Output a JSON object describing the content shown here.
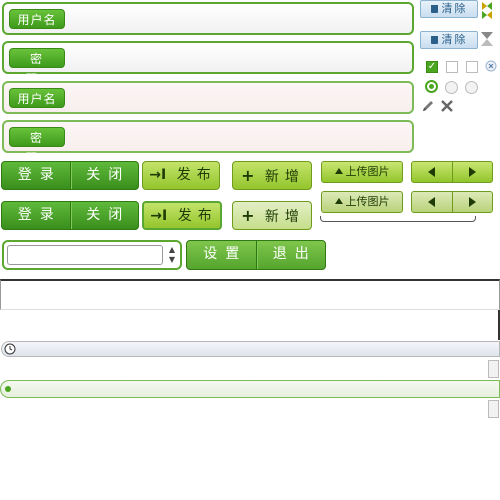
{
  "login_form": {
    "username_label": "用户名",
    "password_label": "密 码",
    "username_label_2": "用户名",
    "password_label_2": "密 码"
  },
  "clear_buttons": {
    "label_1": "清除",
    "label_2": "清除"
  },
  "buttons": {
    "login": "登录",
    "close": "关闭",
    "publish": "发布",
    "add": "新增",
    "upload": "上传图片",
    "settings": "设置",
    "logout": "退出"
  },
  "icons": {
    "publish": "arrow-right-bar-icon",
    "add": "plus-icon",
    "upload": "up-arrow-icon",
    "prev": "triangle-left-icon",
    "next": "triangle-right-icon",
    "clear": "trash-icon",
    "edit": "pencil-icon",
    "delete": "x-icon",
    "remove": "circle-x-icon"
  },
  "checkboxes": [
    {
      "checked": true
    },
    {
      "checked": false
    },
    {
      "checked": false
    }
  ],
  "radios": [
    {
      "selected": true
    },
    {
      "selected": false
    },
    {
      "selected": false
    }
  ],
  "select": {
    "value": ""
  },
  "colors": {
    "primary_green": "#4aa51f",
    "light_green": "#a8d23c",
    "clear_blue": "#c9def0"
  }
}
